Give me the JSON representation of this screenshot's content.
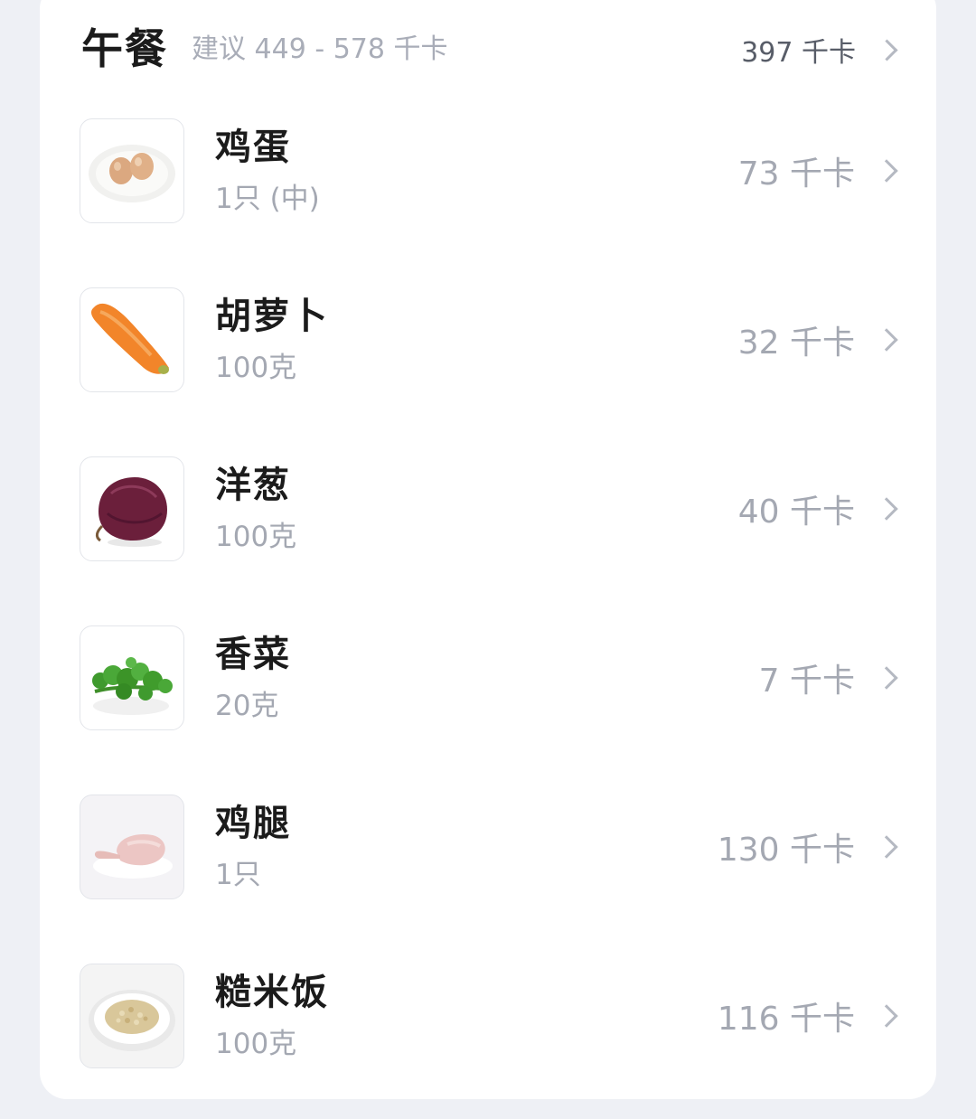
{
  "meal": {
    "title": "午餐",
    "suggestion": "建议 449 - 578 千卡",
    "total": "397 千卡"
  },
  "items": [
    {
      "name": "鸡蛋",
      "quantity": "1只 (中)",
      "calories": "73 千卡",
      "icon": "egg-icon"
    },
    {
      "name": "胡萝卜",
      "quantity": "100克",
      "calories": "32 千卡",
      "icon": "carrot-icon"
    },
    {
      "name": "洋葱",
      "quantity": "100克",
      "calories": "40 千卡",
      "icon": "onion-icon"
    },
    {
      "name": "香菜",
      "quantity": "20克",
      "calories": "7 千卡",
      "icon": "cilantro-icon"
    },
    {
      "name": "鸡腿",
      "quantity": "1只",
      "calories": "130 千卡",
      "icon": "chicken-leg-icon"
    },
    {
      "name": "糙米饭",
      "quantity": "100克",
      "calories": "116 千卡",
      "icon": "brown-rice-icon"
    }
  ],
  "colors": {
    "background": "#eef0f5",
    "card": "#ffffff",
    "title_text": "#1b1b1b",
    "muted_text": "#a4a8b2"
  }
}
